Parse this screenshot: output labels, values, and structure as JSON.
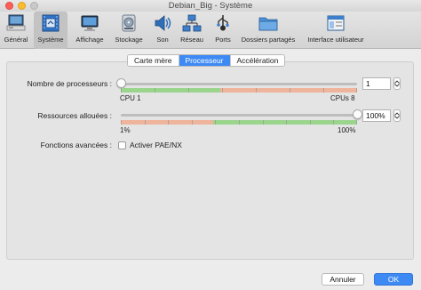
{
  "window": {
    "title": "Debian_Big - Système"
  },
  "toolbar": {
    "items": [
      {
        "label": "Général",
        "icon": "general-icon"
      },
      {
        "label": "Système",
        "icon": "chip-icon",
        "active": true
      },
      {
        "label": "Affichage",
        "icon": "monitor-icon"
      },
      {
        "label": "Stockage",
        "icon": "disk-icon"
      },
      {
        "label": "Son",
        "icon": "speaker-icon"
      },
      {
        "label": "Réseau",
        "icon": "network-icon"
      },
      {
        "label": "Ports",
        "icon": "ports-icon"
      },
      {
        "label": "Dossiers partagés",
        "icon": "folder-icon"
      },
      {
        "label": "Interface utilisateur",
        "icon": "window-icon"
      }
    ]
  },
  "tabs": [
    {
      "label": "Carte mère",
      "selected": false
    },
    {
      "label": "Processeur",
      "selected": true
    },
    {
      "label": "Accélération",
      "selected": false
    }
  ],
  "processors": {
    "label": "Nombre de processeurs :",
    "value": "1",
    "min_label": "CPU 1",
    "max_label": "CPUs 8",
    "min": 1,
    "max": 8,
    "current": 1
  },
  "exec_cap": {
    "label": "Ressources allouées :",
    "value": "100%",
    "min_label": "1%",
    "max_label": "100%",
    "min": 1,
    "max": 100,
    "current": 100
  },
  "extended": {
    "label": "Fonctions avancées :",
    "pae_label": "Activer PAE/NX",
    "pae_checked": false
  },
  "buttons": {
    "cancel": "Annuler",
    "ok": "OK"
  },
  "colors": {
    "accent": "#3e8af4",
    "good_range": "#9bd58d",
    "warn_range": "#efb49c"
  }
}
